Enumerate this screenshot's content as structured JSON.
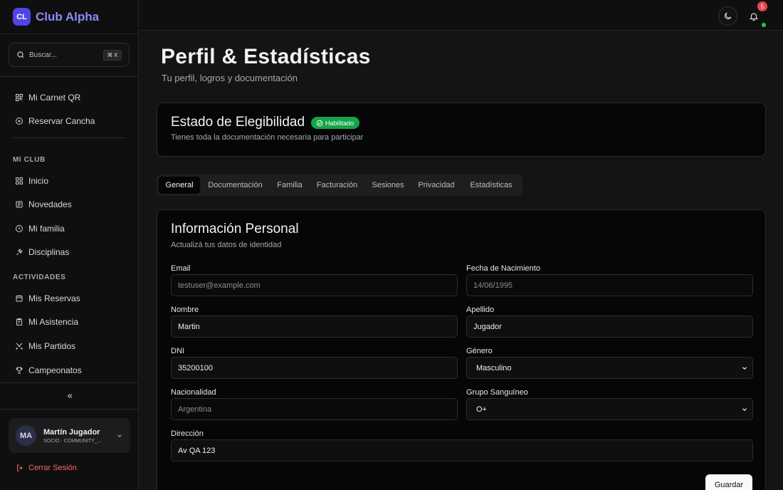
{
  "brand": {
    "logo_initials": "CL",
    "name": "Club Alpha",
    "accent": "#4f46e5"
  },
  "search": {
    "placeholder": "Buscar...",
    "shortcut": "⌘ K"
  },
  "quick_nav": [
    {
      "label": "Mi Carnet QR",
      "icon": "qr-code-icon"
    },
    {
      "label": "Reservar Cancha",
      "icon": "plus-circle-icon"
    }
  ],
  "sections": [
    {
      "title": "MI CLUB",
      "items": [
        {
          "label": "Inicio",
          "icon": "grid-icon"
        },
        {
          "label": "Novedades",
          "icon": "newspaper-icon"
        },
        {
          "label": "Mi familia",
          "icon": "clock-icon"
        },
        {
          "label": "Disciplinas",
          "icon": "activity-icon"
        }
      ]
    },
    {
      "title": "ACTIVIDADES",
      "items": [
        {
          "label": "Mis Reservas",
          "icon": "calendar-icon"
        },
        {
          "label": "Mi Asistencia",
          "icon": "clipboard-icon"
        },
        {
          "label": "Mis Partidos",
          "icon": "swords-icon"
        },
        {
          "label": "Campeonatos",
          "icon": "trophy-icon"
        }
      ]
    }
  ],
  "user": {
    "initials": "MA",
    "name": "Martín Jugador",
    "role": "SOCIO · COMMUNITY_..."
  },
  "logout_label": "Cerrar Sesión",
  "topbar": {
    "notifications_count": "5",
    "online_color": "#22c55e"
  },
  "page": {
    "title": "Perfil & Estadísticas",
    "subtitle": "Tu perfil, logros y documentación"
  },
  "eligibility": {
    "title": "Estado de Elegibilidad",
    "badge": "Habilitado",
    "badge_color": "#16a34a",
    "description": "Tienes toda la documentación necesaria para participar"
  },
  "tabs": [
    "General",
    "Documentación",
    "Familia",
    "Facturación",
    "Sesiones",
    "Privacidad",
    "Estadísticas"
  ],
  "active_tab": "General",
  "form": {
    "title": "Información Personal",
    "subtitle": "Actualizá tus datos de identidad",
    "fields": {
      "email": {
        "label": "Email",
        "value": "testuser@example.com"
      },
      "birthdate": {
        "label": "Fecha de Nacimiento",
        "value": "14/06/1995"
      },
      "first_name": {
        "label": "Nombre",
        "value": "Martin"
      },
      "last_name": {
        "label": "Apellido",
        "value": "Jugador"
      },
      "dni": {
        "label": "DNI",
        "value": "35200100"
      },
      "gender": {
        "label": "Género",
        "value": "Masculino"
      },
      "nationality": {
        "label": "Nacionalidad",
        "value": "Argentina"
      },
      "blood_type": {
        "label": "Grupo Sanguíneo",
        "value": "O+"
      },
      "address": {
        "label": "Dirección",
        "value": "Av QA 123"
      }
    },
    "save_label": "Guardar"
  }
}
